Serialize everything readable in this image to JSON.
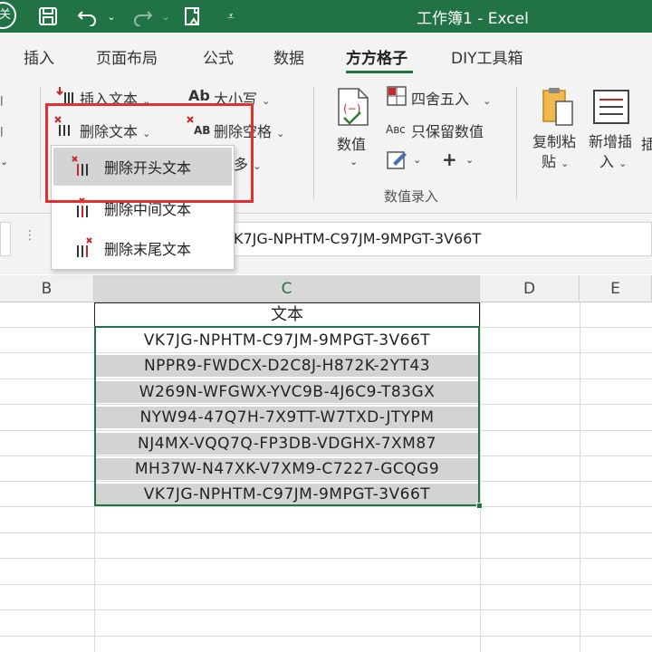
{
  "window": {
    "title": "工作簿1 - Excel",
    "accent_color": "#217346",
    "highlight_color": "#e03131"
  },
  "titlebar": {
    "autosave_label": "关",
    "icons": [
      "save-icon",
      "undo-icon",
      "redo-icon",
      "touch-mode-icon",
      "customize-icon"
    ]
  },
  "tabs": [
    {
      "label": "插入"
    },
    {
      "label": "页面布局"
    },
    {
      "label": "公式"
    },
    {
      "label": "数据"
    },
    {
      "label": "方方格子",
      "active": true
    },
    {
      "label": "DIY工具箱"
    }
  ],
  "ribbon": {
    "insert_text": "插入文本",
    "delete_text": "删除文本",
    "case": "大小写",
    "delete_spaces": "删除空格",
    "more": "多",
    "numeric": "数值",
    "round": "四舍五入",
    "keep_numeric": "只保留数值",
    "group_numeric_entry": "数值录入",
    "copy_paste_line1": "复制粘",
    "copy_paste_line2": "贴",
    "add_insert_line1": "新增插",
    "add_insert_line2": "入",
    "partial_next": "插"
  },
  "dropdown": {
    "items": [
      {
        "label": "删除开头文本",
        "highlighted": true
      },
      {
        "label": "删除中间文本"
      },
      {
        "label": "删除末尾文本"
      }
    ]
  },
  "formula_bar": {
    "value": "VK7JG-NPHTM-C97JM-9MPGT-3V66T"
  },
  "columns": [
    "B",
    "C",
    "D",
    "E"
  ],
  "sheet": {
    "header": "文本",
    "rows": [
      "VK7JG-NPHTM-C97JM-9MPGT-3V66T",
      "NPPR9-FWDCX-D2C8J-H872K-2YT43",
      "W269N-WFGWX-YVC9B-4J6C9-T83GX",
      "NYW94-47Q7H-7X9TT-W7TXD-JTYPM",
      "NJ4MX-VQQ7Q-FP3DB-VDGHX-7XM87",
      "MH37W-N47XK-V7XM9-C7227-GCQG9",
      "VK7JG-NPHTM-C97JM-9MPGT-3V66T"
    ]
  }
}
